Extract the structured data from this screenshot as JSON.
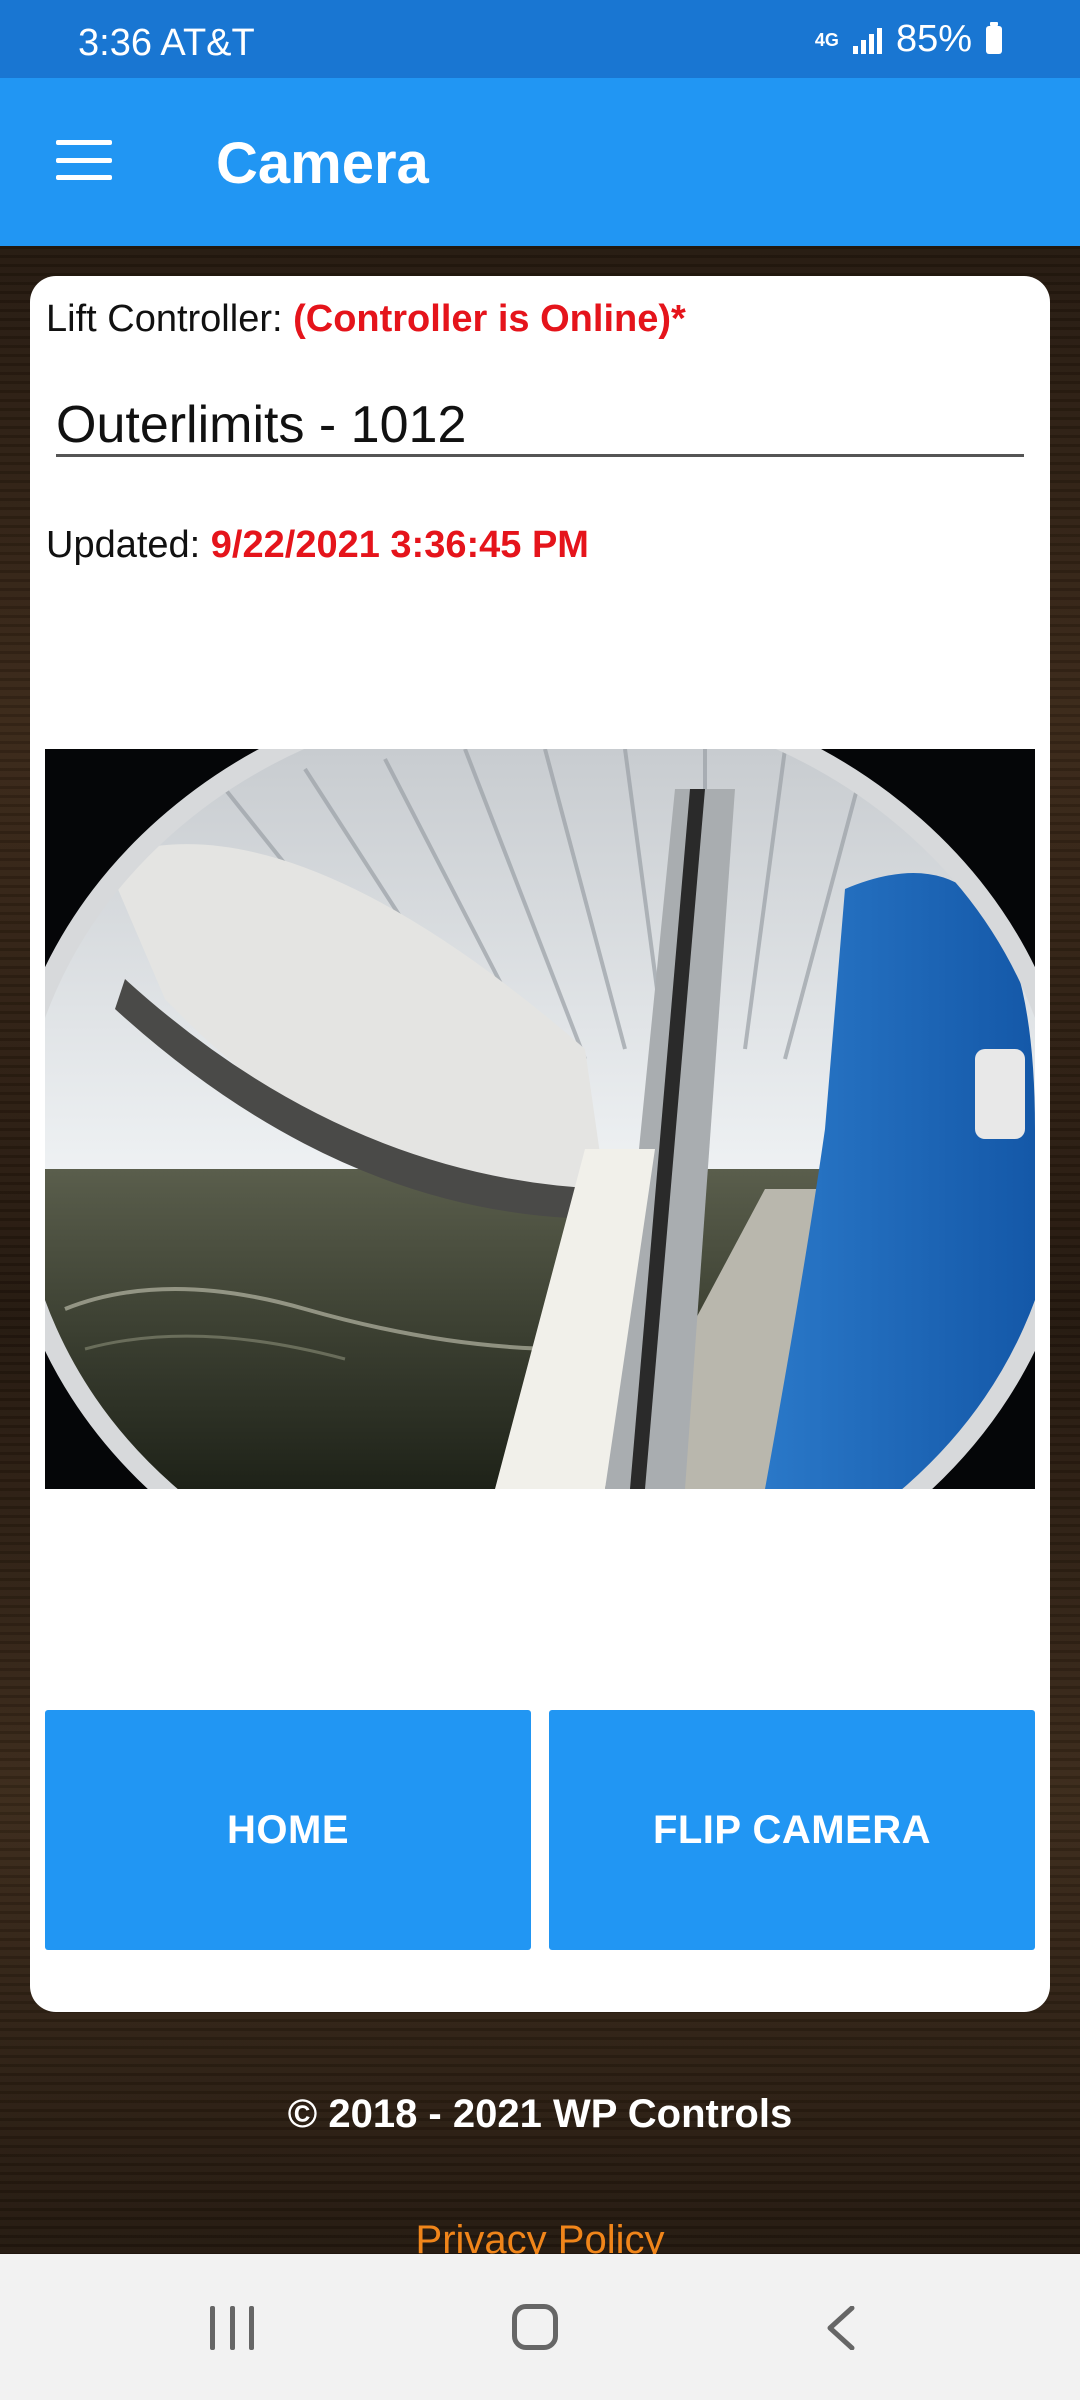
{
  "status_bar": {
    "time_carrier": "3:36 AT&T",
    "network": "4G LTE",
    "battery": "85%"
  },
  "app_bar": {
    "title": "Camera"
  },
  "card": {
    "lift_label": "Lift Controller: ",
    "lift_status": "(Controller is Online)*",
    "device_name": "Outerlimits - 1012",
    "updated_label": "Updated: ",
    "updated_value": "9/22/2021 3:36:45 PM"
  },
  "buttons": {
    "home": "HOME",
    "flip_camera": "FLIP CAMERA"
  },
  "footer": {
    "copyright": "© 2018 - 2021 WP Controls",
    "privacy": "Privacy Policy"
  },
  "colors": {
    "status_bar": "#1976d2",
    "app_bar": "#2196f3",
    "button": "#2196f3",
    "alert_red": "#e5141b",
    "link_orange": "#f0851a"
  }
}
